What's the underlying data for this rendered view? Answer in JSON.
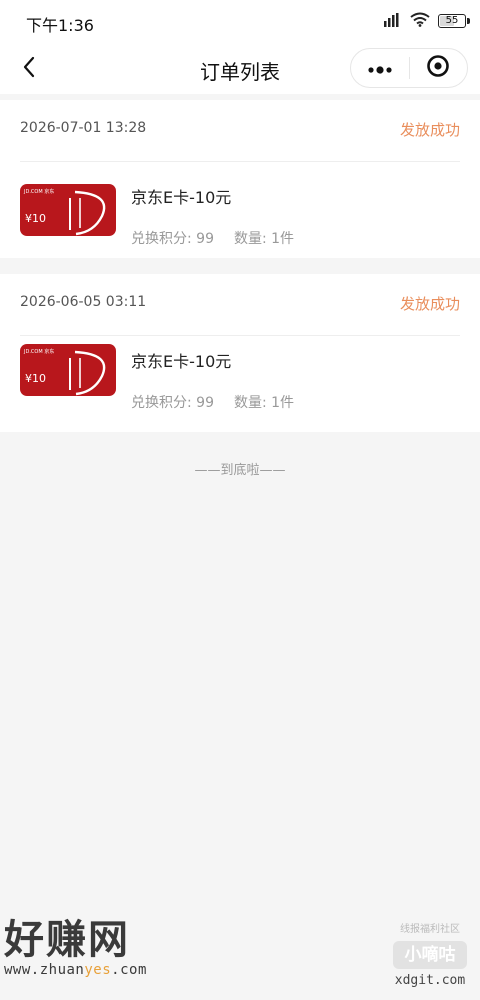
{
  "status_bar": {
    "time": "下午1:36",
    "battery": "55",
    "icons": [
      "signal-icon",
      "wifi-icon",
      "battery-icon"
    ]
  },
  "nav": {
    "title": "订单列表",
    "back_icon": "chevron-left-icon",
    "menu_icon": "more-dots-icon",
    "close_icon": "target-circle-icon"
  },
  "orders": [
    {
      "time": "2026-07-01 13:28",
      "status": "发放成功",
      "product": {
        "name": "京东E卡-10元",
        "card_brand": "JD.COM 京东",
        "card_value": "¥10",
        "points_label": "兑换积分: 99",
        "quantity_label": "数量: 1件"
      }
    },
    {
      "time": "2026-06-05 03:11",
      "status": "发放成功",
      "product": {
        "name": "京东E卡-10元",
        "card_brand": "JD.COM 京东",
        "card_value": "¥10",
        "points_label": "兑换积分: 99",
        "quantity_label": "数量: 1件"
      }
    }
  ],
  "footer_tip": "——到底啦——",
  "watermarks": {
    "left_brand": "好赚网",
    "left_url_prefix": "www.zhuan",
    "left_url_highlight": "yes",
    "left_url_suffix": ".com",
    "right_top": "线报福利社区",
    "right_logo": "小嘀咕",
    "right_url": "xdgit.com"
  },
  "colors": {
    "status_accent": "#e98e5c",
    "card_red": "#b8171c",
    "page_bg": "#f5f5f5"
  }
}
